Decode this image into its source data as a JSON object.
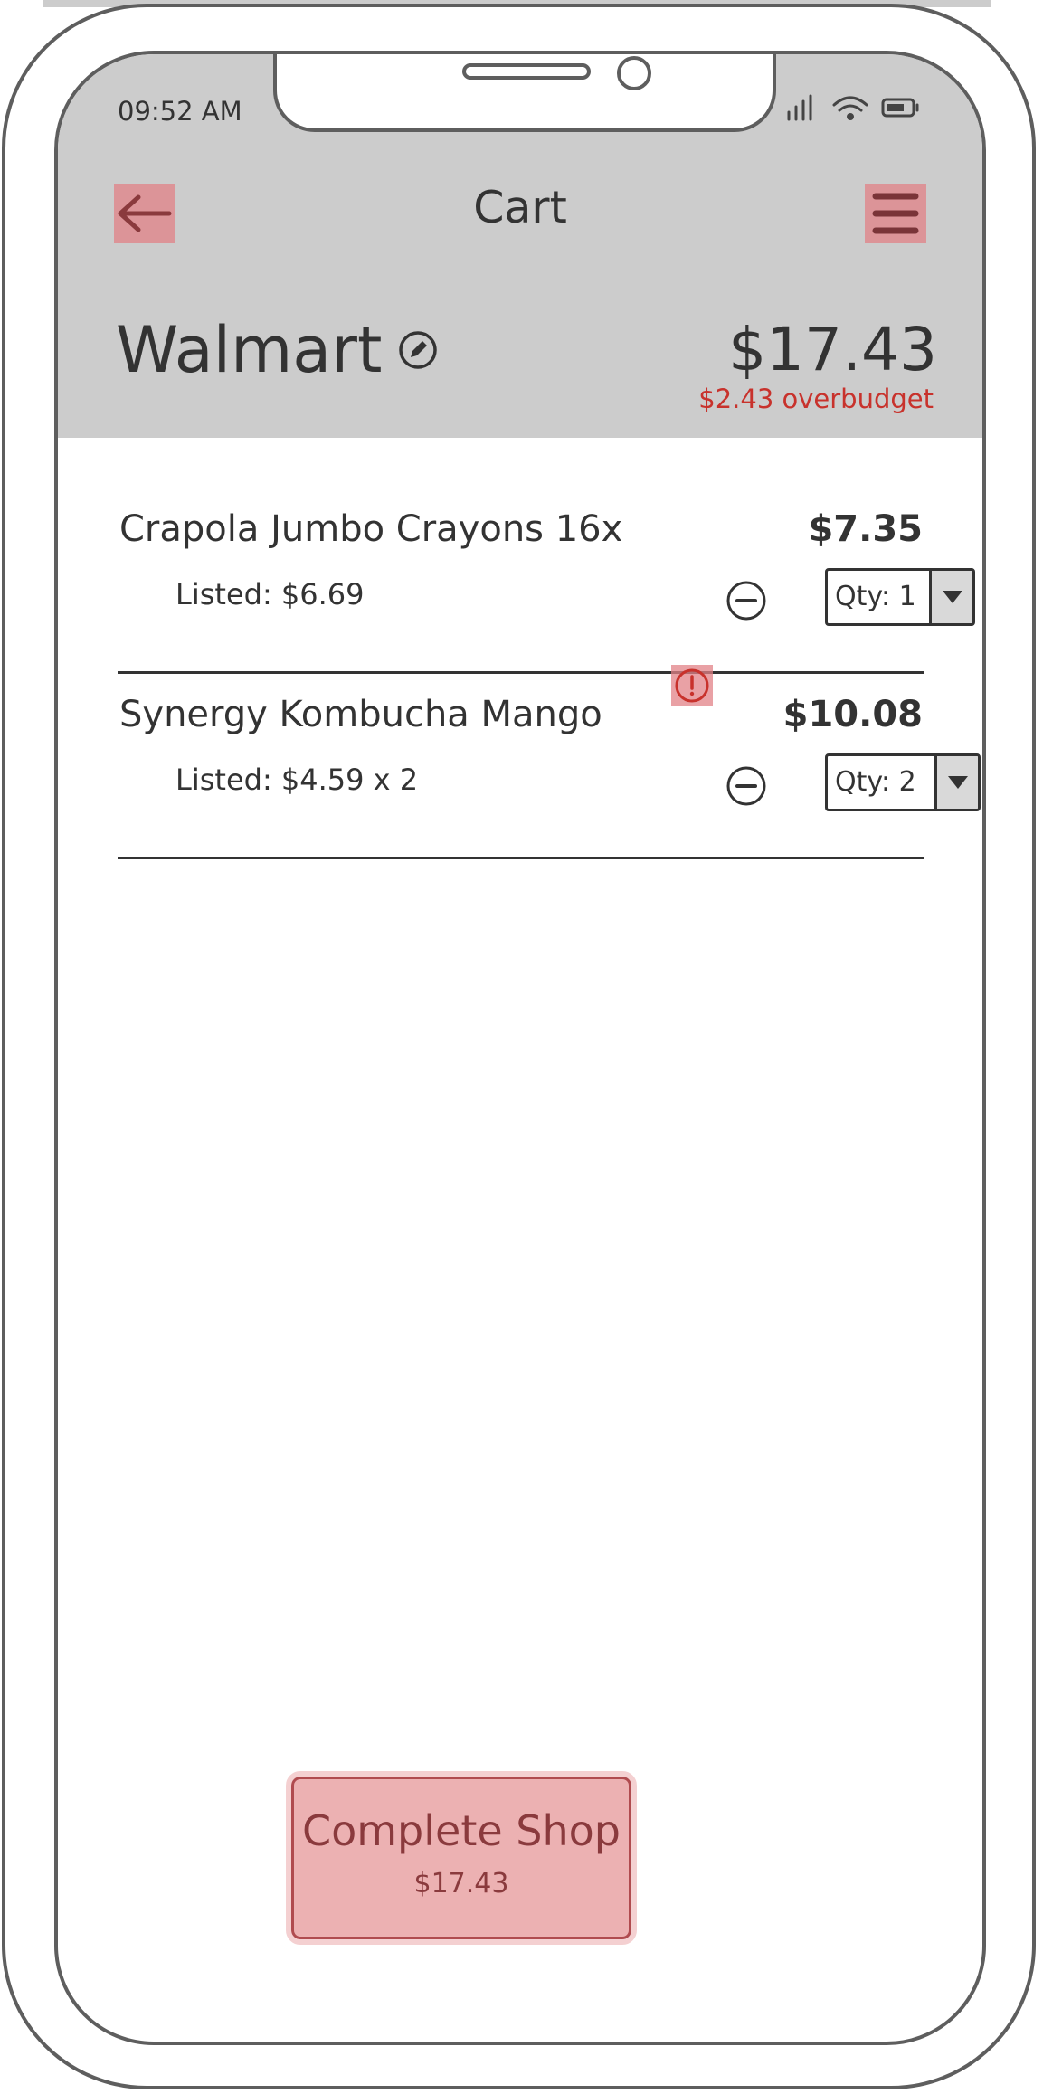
{
  "status_bar": {
    "time": "09:52 AM"
  },
  "header": {
    "title": "Cart",
    "back_icon": "arrow-left-icon",
    "menu_icon": "hamburger-menu-icon"
  },
  "store": {
    "name": "Walmart",
    "total": "$17.43",
    "budget_status": "$2.43 overbudget"
  },
  "items": [
    {
      "name": "Crapola Jumbo Crayons 16x",
      "price": "$7.35",
      "listed": "Listed: $6.69",
      "qty_label": "Qty: 1",
      "warning": false
    },
    {
      "name": "Synergy Kombucha Mango",
      "price": "$10.08",
      "listed": "Listed: $4.59 x 2",
      "qty_label": "Qty: 2",
      "warning": true
    }
  ],
  "footer": {
    "button_label": "Complete Shop",
    "button_amount": "$17.43"
  },
  "colors": {
    "header_bg": "#cccccc",
    "accent_tap": "#e18287",
    "overbudget": "#c8322c",
    "button_bg": "#ecb1b2"
  }
}
